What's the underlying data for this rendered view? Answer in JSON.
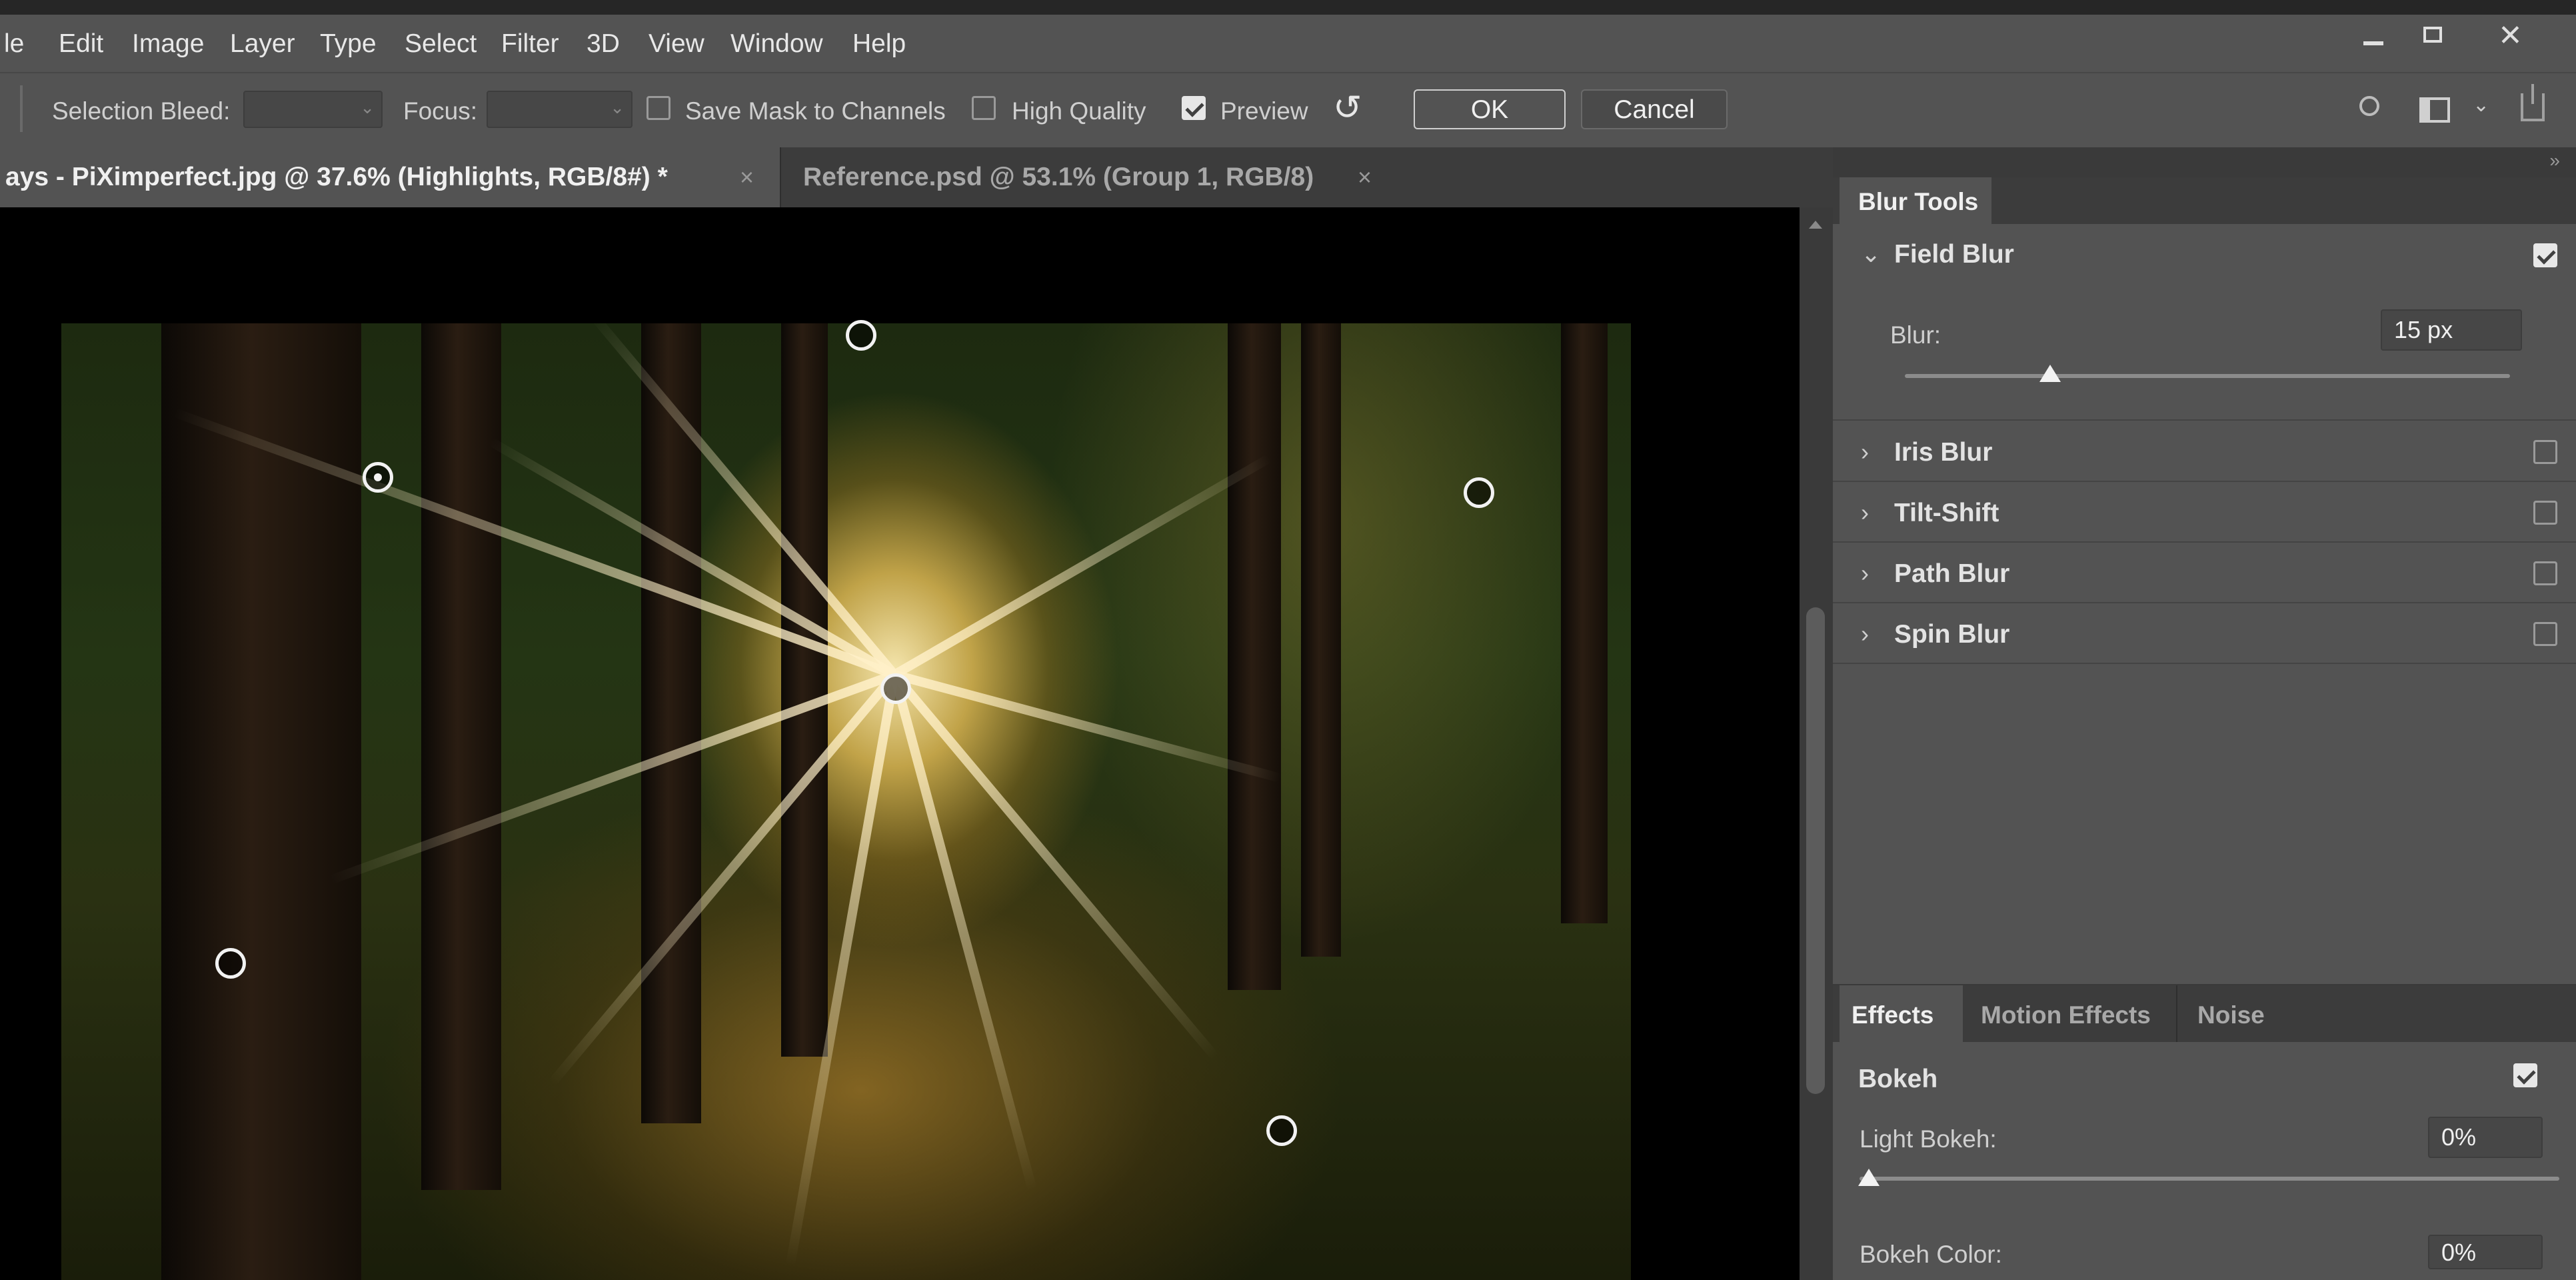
{
  "menu": {
    "items": [
      "le",
      "Edit",
      "Image",
      "Layer",
      "Type",
      "Select",
      "Filter",
      "3D",
      "View",
      "Window",
      "Help"
    ]
  },
  "options_bar": {
    "selection_bleed_label": "Selection Bleed:",
    "focus_label": "Focus:",
    "save_mask_label": "Save Mask to Channels",
    "save_mask_checked": false,
    "high_quality_label": "High Quality",
    "high_quality_checked": false,
    "preview_label": "Preview",
    "preview_checked": true,
    "ok_label": "OK",
    "cancel_label": "Cancel",
    "icons": [
      "reset-icon",
      "search-icon",
      "workspace-icon",
      "chevron-down-icon",
      "share-icon"
    ]
  },
  "document_tabs": [
    {
      "label": "ays - PiXimperfect.jpg @ 37.6% (Highlights, RGB/8#) *",
      "active": true
    },
    {
      "label": "Reference.psd @ 53.1% (Group 1, RGB/8)",
      "active": false
    }
  ],
  "canvas": {
    "pins_count": 6
  },
  "blur_tools": {
    "tab_label": "Blur Tools",
    "field_blur": {
      "title": "Field Blur",
      "checked": true,
      "blur_label": "Blur:",
      "blur_value": "15 px",
      "blur_level": 0.24
    },
    "collapsed": [
      {
        "title": "Iris Blur",
        "checked": false
      },
      {
        "title": "Tilt-Shift",
        "checked": false
      },
      {
        "title": "Path Blur",
        "checked": false
      },
      {
        "title": "Spin Blur",
        "checked": false
      }
    ]
  },
  "effects": {
    "tabs": [
      "Effects",
      "Motion Effects",
      "Noise"
    ],
    "bokeh_title": "Bokeh",
    "bokeh_checked": true,
    "light_bokeh_label": "Light Bokeh:",
    "light_bokeh_value": "0%",
    "light_bokeh_level": 0.0,
    "bokeh_color_label": "Bokeh Color:",
    "bokeh_color_value": "0%"
  },
  "window_controls": [
    "minimize-icon",
    "restore-icon",
    "close-icon"
  ]
}
